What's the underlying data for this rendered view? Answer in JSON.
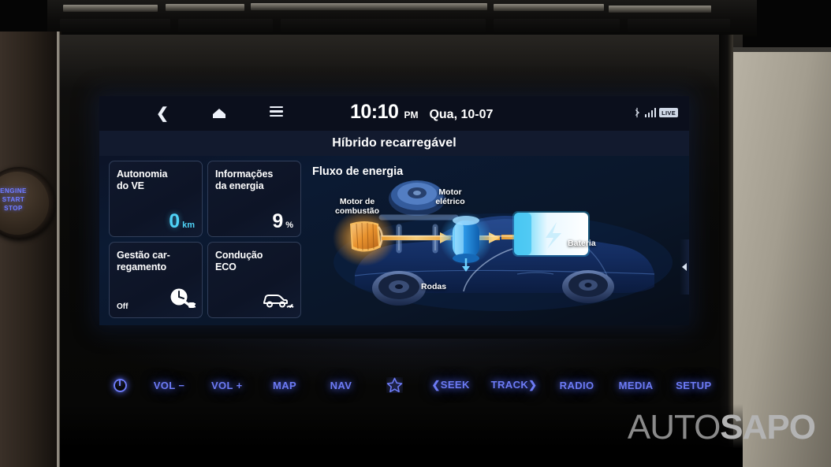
{
  "statusbar": {
    "back_icon": "chevron-left-icon",
    "home_icon": "home-icon",
    "menu_icon": "hamburger-menu-icon",
    "time": "10:10",
    "ampm": "PM",
    "date": "Qua, 10-07",
    "bluetooth_icon": "bluetooth-icon",
    "signal_icon": "signal-bars-icon",
    "live_badge": "LIVE"
  },
  "title": "Híbrido recarregável",
  "cards": [
    {
      "title": "Autonomia\ndo VE",
      "title_line1": "Autonomia",
      "title_line2": "do VE",
      "value": "0",
      "unit": "km",
      "value_color": "#4fd3f7"
    },
    {
      "title_line1": "Informações",
      "title_line2": "da energia",
      "value": "9",
      "unit": "%",
      "value_color": "#ffffff"
    },
    {
      "title_line1": "Gestão car-",
      "title_line2": "regamento",
      "state": "Off",
      "icon": "charge-timer-icon"
    },
    {
      "title_line1": "Condução",
      "title_line2": "ECO",
      "icon": "eco-car-icon"
    }
  ],
  "flow": {
    "title": "Fluxo de energia",
    "label_engine_l1": "Motor de",
    "label_engine_l2": "combustão",
    "label_emotor_l1": "Motor",
    "label_emotor_l2": "elétrico",
    "label_battery": "Bateria",
    "label_wheels": "Rodas",
    "battery_icon": "lightning-bolt-icon",
    "colors": {
      "engine": "#f0a73c",
      "emotor": "#3aa6f0",
      "battery": "#6fd8f8",
      "flow_arrow": "#f0a030",
      "car_body": "#1b3f8e"
    }
  },
  "collapse_arrow_icon": "chevron-left-icon",
  "hardkeys": [
    {
      "label": "",
      "icon": "power-icon"
    },
    {
      "label": "VOL −"
    },
    {
      "label": "VOL +"
    },
    {
      "label": "MAP"
    },
    {
      "label": "NAV"
    },
    {
      "label": "",
      "icon": "star-icon"
    },
    {
      "label": "❮SEEK"
    },
    {
      "label": "TRACK❯"
    },
    {
      "label": "RADIO"
    },
    {
      "label": "MEDIA"
    },
    {
      "label": "SETUP"
    }
  ],
  "start_stop_button": {
    "line1": "ENGINE",
    "line2": "START",
    "line3": "STOP"
  },
  "watermark": {
    "thin": "AUTO",
    "bold": "SAPO"
  }
}
